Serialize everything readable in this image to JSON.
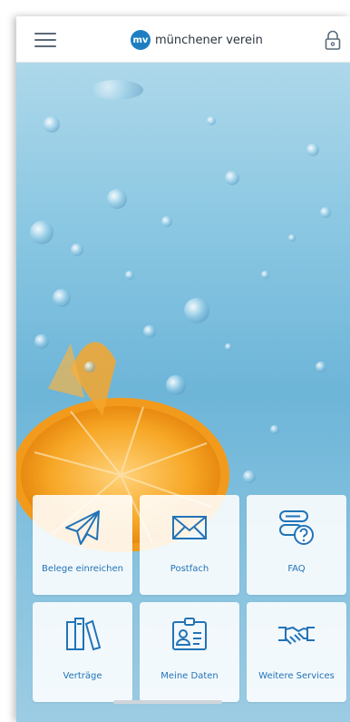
{
  "header": {
    "logo_text": "mv",
    "brand_name": "münchener verein"
  },
  "icons": {
    "menu": "hamburger-icon",
    "lock": "lock-icon"
  },
  "tiles": [
    {
      "label": "Belege einreichen",
      "icon": "paper-plane-icon"
    },
    {
      "label": "Postfach",
      "icon": "envelope-icon"
    },
    {
      "label": "FAQ",
      "icon": "faq-icon"
    },
    {
      "label": "Verträge",
      "icon": "books-icon"
    },
    {
      "label": "Meine Daten",
      "icon": "id-card-icon"
    },
    {
      "label": "Weitere Services",
      "icon": "handshake-icon"
    }
  ],
  "colors": {
    "accent": "#2273b7",
    "brand": "#1d7fc1"
  }
}
